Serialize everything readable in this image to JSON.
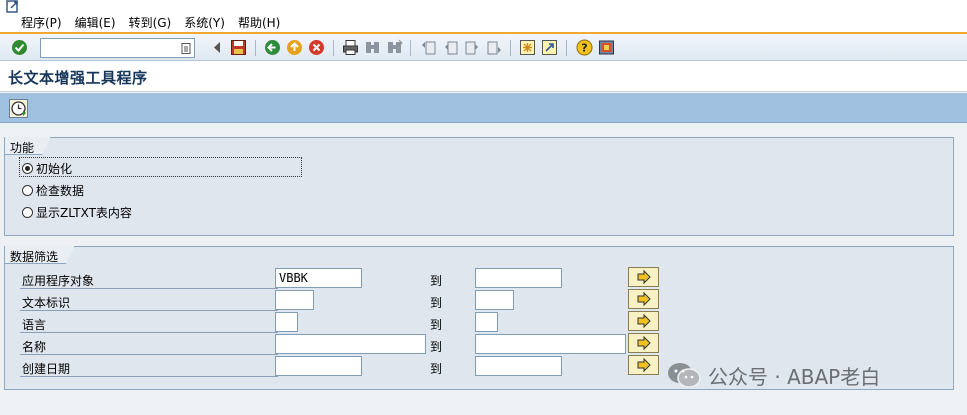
{
  "menu": {
    "items": [
      "程序(P)",
      "编辑(E)",
      "转到(G)",
      "系统(Y)",
      "帮助(H)"
    ]
  },
  "toolbar": {
    "command_value": "",
    "buttons": [
      "enter",
      "back-nav",
      "save",
      "back",
      "exit",
      "cancel",
      "print",
      "find",
      "find-next",
      "first-page",
      "previous-page",
      "next-page",
      "last-page",
      "create-session",
      "create-shortcut",
      "help",
      "customize-layout"
    ]
  },
  "screen": {
    "title": "长文本增强工具程序"
  },
  "function_group": {
    "title": "功能",
    "options": [
      {
        "label": "初始化",
        "selected": true
      },
      {
        "label": "检查数据",
        "selected": false
      },
      {
        "label": "显示ZLTXT表内容",
        "selected": false
      }
    ]
  },
  "filter_group": {
    "title": "数据筛选",
    "to_label": "到",
    "rows": [
      {
        "label": "应用程序对象",
        "low": "VBBK",
        "high": ""
      },
      {
        "label": "文本标识",
        "low": "",
        "high": ""
      },
      {
        "label": "语言",
        "low": "",
        "high": ""
      },
      {
        "label": "名称",
        "low": "",
        "high": ""
      },
      {
        "label": "创建日期",
        "low": "",
        "high": ""
      }
    ]
  },
  "watermark": {
    "text": "公众号 · ABAP老白"
  }
}
